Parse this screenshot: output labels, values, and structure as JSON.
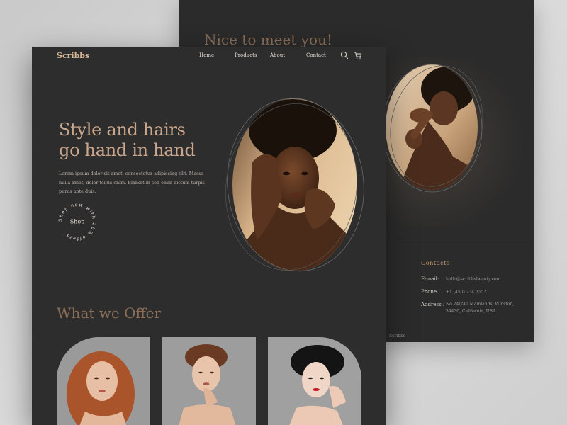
{
  "back_page": {
    "heading": "Nice to meet you!",
    "contacts": {
      "title": "Contacts",
      "email_label": "E-mail:",
      "email_value": "hello@scribbsbeauty.com",
      "phone_label": "Phone :",
      "phone_value": "+1 (450) 234 3552",
      "address_label": "Address :",
      "address_line1": "No 24/246 Mainlands, Winston,",
      "address_line2": "34430, California, USA."
    },
    "footer_logo": "Scribbs"
  },
  "front_page": {
    "logo": "Scribbs",
    "nav": {
      "home": "Home",
      "products": "Products",
      "about": "About",
      "contact": "Contact",
      "search_icon": "search-icon",
      "cart_icon": "cart-icon"
    },
    "hero": {
      "title_line1": "Style and hairs",
      "title_line2": "go hand in hand",
      "body_line1": "Lorem ipsum dolor sit amet, consectetur adipiscing elit. Massa",
      "body_line2": "nulla amet, dolor tellus enim. Blandit in sed enim dictum turpis",
      "body_line3": "purus ante duis.",
      "shop_label": "Shop",
      "badge_ring_text": "Shop now with 20% offers"
    },
    "offer_title": "What we Offer"
  },
  "colors": {
    "accent": "#caa78c",
    "muted_accent": "#8a6e57",
    "dark_bg": "#2d2d2d",
    "page_bg": "#d4d4d4"
  }
}
